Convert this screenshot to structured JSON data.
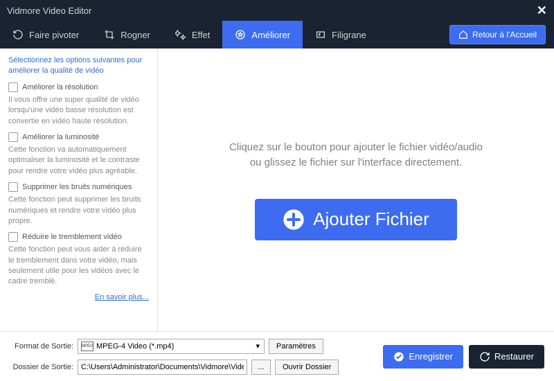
{
  "app": {
    "title": "Vidmore Video Editor"
  },
  "tabs": {
    "rotate": "Faire pivoter",
    "crop": "Rogner",
    "effect": "Effet",
    "enhance": "Améliorer",
    "watermark": "Filigrane"
  },
  "home_button": "Retour à l'Accueil",
  "sidebar": {
    "title": "Sélectionnez les options suivantes pour améliorer la qualité de vidéo",
    "options": [
      {
        "label": "Améliorer la résolution",
        "desc": "Il vous offre une super qualité de vidéo lorsqu'une vidéo basse résolution est convertie en vidéo haute résolution."
      },
      {
        "label": "Améliorer la luminosité",
        "desc": "Cette fonction va automatiquement optimaliser la luminosité et le contraste pour rendre votre vidéo plus agréable."
      },
      {
        "label": "Supprimer les bruits numériques",
        "desc": "Cette fonction peut supprimer les bruits numériques et rendre votre vidéo plus propre."
      },
      {
        "label": "Réduire le tremblement vidéo",
        "desc": "Cette fonction peut vous aider à réduire le tremblement dans votre vidéo, mais seulement utile pour les vidéos avec le cadre tremblé."
      }
    ],
    "learn_more": "En savoir plus..."
  },
  "content": {
    "drop_text": "Cliquez sur le bouton pour ajouter le fichier vidéo/audio ou glissez le fichier sur l'interface directement.",
    "add_file": "Ajouter Fichier"
  },
  "bottom": {
    "format_label": "Format de Sortie:",
    "format_value": "MPEG-4 Video (*.mp4)",
    "settings": "Paramètres",
    "folder_label": "Dossier de Sortie:",
    "folder_value": "C:\\Users\\Administrator\\Documents\\Vidmore\\Video",
    "browse": "...",
    "open_folder": "Ouvrir Dossier",
    "save": "Enregistrer",
    "restore": "Restaurer"
  }
}
